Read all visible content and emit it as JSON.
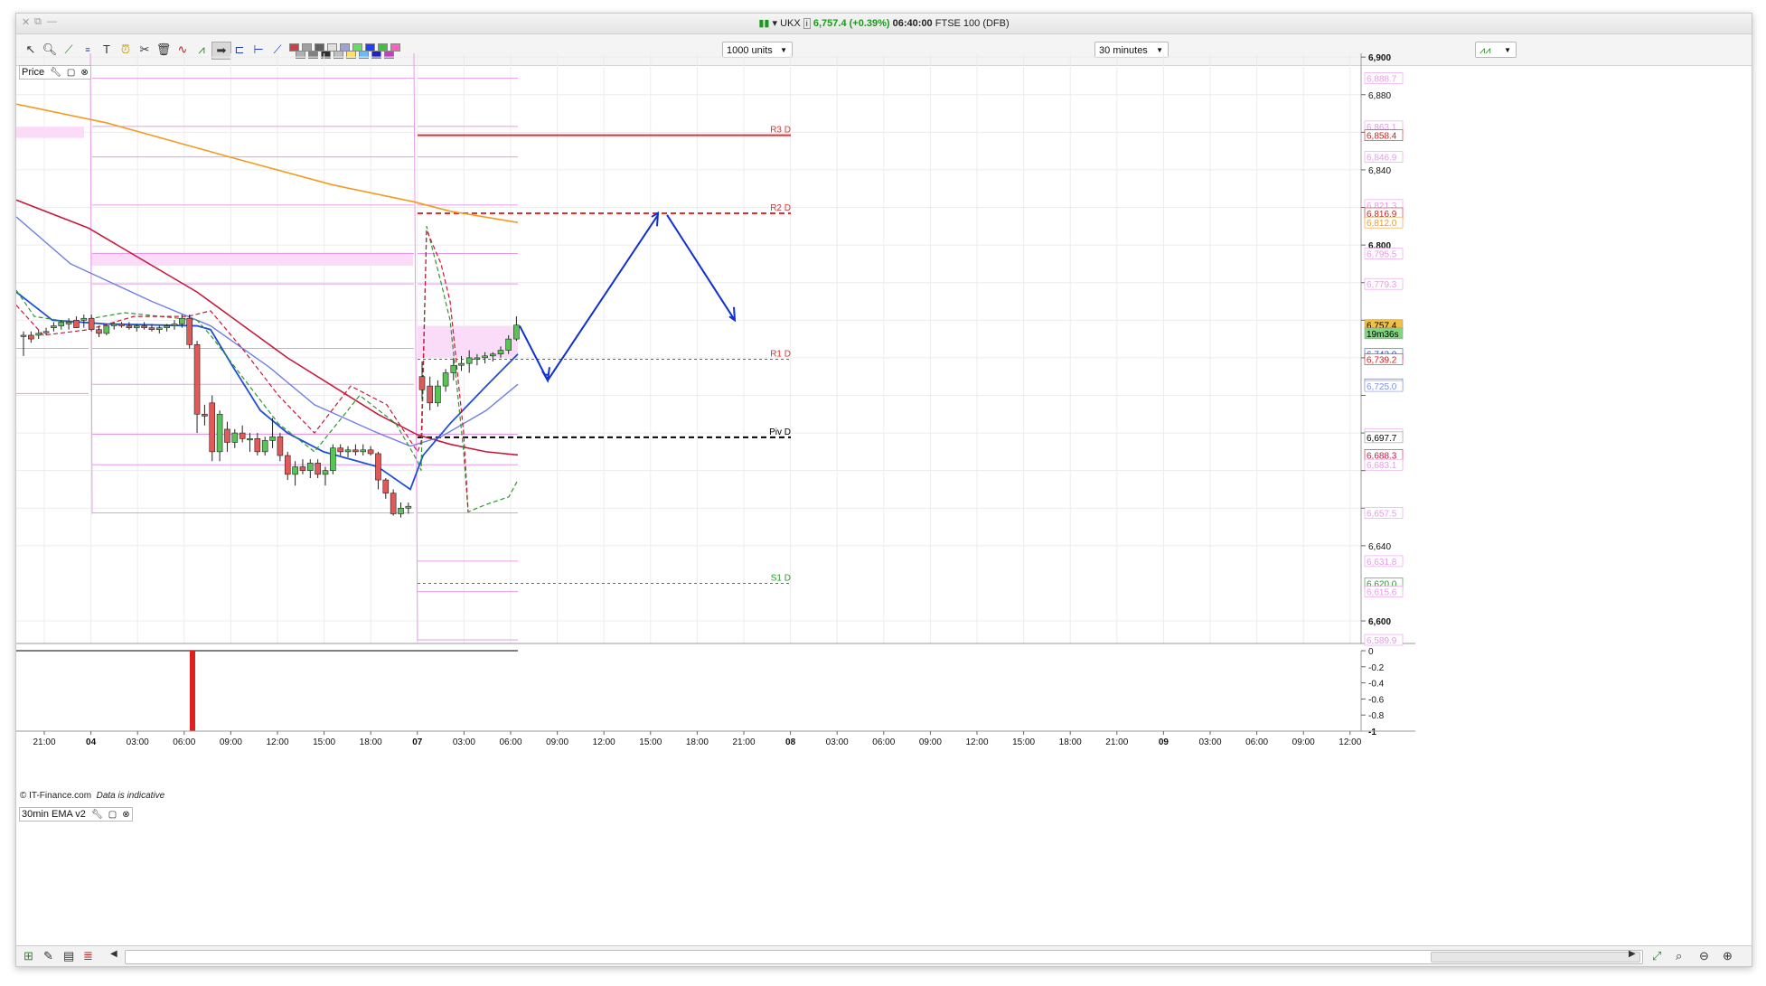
{
  "window": {
    "title_symbol": "UKX",
    "title_price": "6,757.4",
    "title_change": "(+0.39%)",
    "title_time": "06:40:00",
    "title_market": "FTSE 100 (DFB)"
  },
  "toolbar": {
    "size_select": "1000 units",
    "timeframe_select": "30 minutes",
    "icons": [
      "pointer-icon",
      "zoom-icon",
      "chart-line-icon",
      "fibonacci-icon",
      "text-icon",
      "alarm-icon",
      "tools-icon",
      "trash-icon",
      "indicator-icon",
      "wave-icon",
      "arrow-icon",
      "channel-icon",
      "horizontal-line-icon",
      "trendline-icon"
    ],
    "palette": [
      "#d04040",
      "#b0b0b0",
      "#a0a0a0",
      "#808080",
      "#606060",
      "#303030",
      "#e0e0e0",
      "#c0c0c0",
      "#a0a0e0",
      "#ffe060",
      "#60e060",
      "#60c0ff",
      "#2040ff",
      "#2020c0",
      "#40c040",
      "#c040c0",
      "#ff60c0"
    ]
  },
  "panels": {
    "price_label": "Price",
    "indicator_label": "30min EMA v2",
    "credit": "© IT-Finance.com",
    "credit_note": "Data is indicative"
  },
  "colors": {
    "candle_up": "#56c556",
    "candle_down": "#e05a5a",
    "ema_blue": "#1f4fd8",
    "ema_lightblue": "#7080e8",
    "ema_red": "#c8183c",
    "ema_orange": "#f39a20",
    "pivot_pink": "#e79be7",
    "pivot_zone": "#fadcf8",
    "forecast_arrow": "#1030d0"
  },
  "chart_data": {
    "type": "candlestick",
    "instrument": "FTSE 100 (DFB)",
    "timeframe": "30 minutes",
    "price_axis": {
      "min": 6588,
      "max": 6902,
      "ticks": [
        6600,
        6640,
        6660,
        6680,
        6700,
        6720,
        6740,
        6760,
        6780,
        6800,
        6820,
        6840,
        6860,
        6880,
        6900
      ],
      "bold_ticks": [
        6600,
        6700,
        6800,
        6900
      ],
      "unlabeled_ticks": [
        6660,
        6680,
        6720,
        6760
      ]
    },
    "time_axis": {
      "labels": [
        "21:00",
        "04",
        "03:00",
        "06:00",
        "09:00",
        "12:00",
        "15:00",
        "18:00",
        "07",
        "03:00",
        "06:00",
        "09:00",
        "12:00",
        "15:00",
        "18:00",
        "21:00",
        "08",
        "03:00",
        "06:00",
        "09:00",
        "12:00",
        "15:00",
        "18:00",
        "21:00",
        "09",
        "03:00",
        "06:00",
        "09:00",
        "12:00"
      ],
      "bold_labels": [
        "04",
        "07",
        "08",
        "09"
      ]
    },
    "candles": [
      {
        "t": "04 20:00",
        "o": 6752,
        "h": 6754,
        "l": 6741,
        "c": 6752
      },
      {
        "t": "04 20:30",
        "o": 6752,
        "h": 6754,
        "l": 6748,
        "c": 6750
      },
      {
        "t": "04 21:00",
        "o": 6752,
        "h": 6755,
        "l": 6750,
        "c": 6753
      },
      {
        "t": "04 21:30",
        "o": 6754,
        "h": 6756,
        "l": 6752,
        "c": 6754
      },
      {
        "t": "04 22:00",
        "o": 6756,
        "h": 6759,
        "l": 6754,
        "c": 6757
      },
      {
        "t": "04 22:30",
        "o": 6757,
        "h": 6760,
        "l": 6755,
        "c": 6759
      },
      {
        "t": "04 23:00",
        "o": 6758,
        "h": 6761,
        "l": 6755,
        "c": 6759
      },
      {
        "t": "04 23:30",
        "o": 6760,
        "h": 6762,
        "l": 6756,
        "c": 6756
      },
      {
        "t": "05 00:00",
        "o": 6760,
        "h": 6763,
        "l": 6756,
        "c": 6761
      },
      {
        "t": "05 00:30",
        "o": 6761,
        "h": 6763,
        "l": 6754,
        "c": 6755
      },
      {
        "t": "05 01:00",
        "o": 6755,
        "h": 6757,
        "l": 6751,
        "c": 6753
      },
      {
        "t": "05 01:30",
        "o": 6753,
        "h": 6758,
        "l": 6752,
        "c": 6757
      },
      {
        "t": "05 02:00",
        "o": 6757,
        "h": 6759,
        "l": 6755,
        "c": 6758
      },
      {
        "t": "05 02:30",
        "o": 6758,
        "h": 6759,
        "l": 6756,
        "c": 6757
      },
      {
        "t": "05 03:00",
        "o": 6757,
        "h": 6759,
        "l": 6755,
        "c": 6756
      },
      {
        "t": "05 03:30",
        "o": 6756,
        "h": 6758,
        "l": 6754,
        "c": 6757
      },
      {
        "t": "05 04:00",
        "o": 6757,
        "h": 6759,
        "l": 6755,
        "c": 6756
      },
      {
        "t": "05 04:30",
        "o": 6756,
        "h": 6758,
        "l": 6754,
        "c": 6755
      },
      {
        "t": "05 05:00",
        "o": 6755,
        "h": 6757,
        "l": 6753,
        "c": 6756
      },
      {
        "t": "05 05:30",
        "o": 6756,
        "h": 6758,
        "l": 6754,
        "c": 6757
      },
      {
        "t": "05 06:00",
        "o": 6757,
        "h": 6760,
        "l": 6755,
        "c": 6758
      },
      {
        "t": "05 06:30",
        "o": 6758,
        "h": 6763,
        "l": 6756,
        "c": 6761
      },
      {
        "t": "05 07:00",
        "o": 6761,
        "h": 6763,
        "l": 6745,
        "c": 6747
      },
      {
        "t": "05 07:30",
        "o": 6747,
        "h": 6749,
        "l": 6700,
        "c": 6710
      },
      {
        "t": "05 08:00",
        "o": 6710,
        "h": 6715,
        "l": 6704,
        "c": 6709
      },
      {
        "t": "05 08:30",
        "o": 6716,
        "h": 6720,
        "l": 6685,
        "c": 6690
      },
      {
        "t": "05 09:00",
        "o": 6690,
        "h": 6712,
        "l": 6685,
        "c": 6710
      },
      {
        "t": "05 09:30",
        "o": 6702,
        "h": 6706,
        "l": 6690,
        "c": 6695
      },
      {
        "t": "05 10:00",
        "o": 6695,
        "h": 6702,
        "l": 6692,
        "c": 6700
      },
      {
        "t": "05 10:30",
        "o": 6700,
        "h": 6704,
        "l": 6695,
        "c": 6697
      },
      {
        "t": "05 11:00",
        "o": 6697,
        "h": 6700,
        "l": 6690,
        "c": 6697
      },
      {
        "t": "05 11:30",
        "o": 6697,
        "h": 6700,
        "l": 6688,
        "c": 6690
      },
      {
        "t": "05 12:00",
        "o": 6690,
        "h": 6698,
        "l": 6688,
        "c": 6696
      },
      {
        "t": "05 12:30",
        "o": 6696,
        "h": 6708,
        "l": 6692,
        "c": 6698
      },
      {
        "t": "05 13:00",
        "o": 6698,
        "h": 6700,
        "l": 6685,
        "c": 6688
      },
      {
        "t": "05 13:30",
        "o": 6688,
        "h": 6690,
        "l": 6675,
        "c": 6678
      },
      {
        "t": "05 14:00",
        "o": 6678,
        "h": 6685,
        "l": 6672,
        "c": 6682
      },
      {
        "t": "05 14:30",
        "o": 6682,
        "h": 6686,
        "l": 6678,
        "c": 6680
      },
      {
        "t": "05 15:00",
        "o": 6680,
        "h": 6686,
        "l": 6676,
        "c": 6684
      },
      {
        "t": "05 15:30",
        "o": 6684,
        "h": 6686,
        "l": 6676,
        "c": 6678
      },
      {
        "t": "05 16:00",
        "o": 6678,
        "h": 6682,
        "l": 6672,
        "c": 6680
      },
      {
        "t": "05 16:30",
        "o": 6680,
        "h": 6694,
        "l": 6678,
        "c": 6692
      },
      {
        "t": "05 17:00",
        "o": 6692,
        "h": 6694,
        "l": 6688,
        "c": 6690
      },
      {
        "t": "05 17:30",
        "o": 6690,
        "h": 6693,
        "l": 6687,
        "c": 6691
      },
      {
        "t": "05 18:00",
        "o": 6691,
        "h": 6694,
        "l": 6688,
        "c": 6690
      },
      {
        "t": "05 18:30",
        "o": 6690,
        "h": 6694,
        "l": 6688,
        "c": 6691
      },
      {
        "t": "05 19:00",
        "o": 6691,
        "h": 6693,
        "l": 6688,
        "c": 6689
      },
      {
        "t": "05 19:30",
        "o": 6689,
        "h": 6690,
        "l": 6670,
        "c": 6675
      },
      {
        "t": "05 20:00",
        "o": 6675,
        "h": 6676,
        "l": 6665,
        "c": 6668
      },
      {
        "t": "05 20:30",
        "o": 6668,
        "h": 6670,
        "l": 6656,
        "c": 6657
      },
      {
        "t": "05 21:00",
        "o": 6657,
        "h": 6663,
        "l": 6655,
        "c": 6660
      },
      {
        "t": "05 21:30",
        "o": 6660,
        "h": 6663,
        "l": 6657,
        "c": 6661
      },
      {
        "t": "07 00:00",
        "o": 6730,
        "h": 6738,
        "l": 6718,
        "c": 6723
      },
      {
        "t": "07 00:30",
        "o": 6725,
        "h": 6730,
        "l": 6712,
        "c": 6716
      },
      {
        "t": "07 01:00",
        "o": 6716,
        "h": 6728,
        "l": 6714,
        "c": 6725
      },
      {
        "t": "07 01:30",
        "o": 6725,
        "h": 6734,
        "l": 6722,
        "c": 6732
      },
      {
        "t": "07 02:00",
        "o": 6732,
        "h": 6740,
        "l": 6728,
        "c": 6736
      },
      {
        "t": "07 02:30",
        "o": 6736,
        "h": 6741,
        "l": 6733,
        "c": 6737
      },
      {
        "t": "07 03:00",
        "o": 6737,
        "h": 6744,
        "l": 6732,
        "c": 6740
      },
      {
        "t": "07 03:30",
        "o": 6740,
        "h": 6742,
        "l": 6736,
        "c": 6740
      },
      {
        "t": "07 04:00",
        "o": 6740,
        "h": 6743,
        "l": 6737,
        "c": 6741
      },
      {
        "t": "07 04:30",
        "o": 6741,
        "h": 6743,
        "l": 6738,
        "c": 6742
      },
      {
        "t": "07 05:00",
        "o": 6742,
        "h": 6746,
        "l": 6740,
        "c": 6744
      },
      {
        "t": "07 05:30",
        "o": 6744,
        "h": 6752,
        "l": 6742,
        "c": 6750
      },
      {
        "t": "07 06:00",
        "o": 6750,
        "h": 6762,
        "l": 6749,
        "c": 6757.4
      }
    ],
    "pivot_levels": [
      {
        "name": "R3 D",
        "value": 6858.4,
        "color": "#e03030",
        "style": "solid"
      },
      {
        "name": "R2 D",
        "value": 6816.9,
        "color": "#e03030",
        "style": "dashed"
      },
      {
        "name": "R1 D",
        "value": 6739.2,
        "color": "#e03030",
        "style": "dotted"
      },
      {
        "name": "Piv D",
        "value": 6697.7,
        "color": "#000000",
        "style": "dashed"
      },
      {
        "name": "S1 D",
        "value": 6620.0,
        "color": "#2a9a2a",
        "style": "dotted"
      }
    ],
    "price_labels": [
      {
        "value": 6888.7,
        "text": "6,888.7",
        "bg": "#fff",
        "fg": "#e79be7"
      },
      {
        "value": 6863.1,
        "text": "6,863.1",
        "bg": "#fff",
        "fg": "#e79be7"
      },
      {
        "value": 6858.4,
        "text": "6,858.4",
        "bg": "#fff",
        "fg": "#d02020"
      },
      {
        "value": 6846.9,
        "text": "6,846.9",
        "bg": "#fff",
        "fg": "#e79be7"
      },
      {
        "value": 6821.3,
        "text": "6,821.3",
        "bg": "#fff",
        "fg": "#e79be7"
      },
      {
        "value": 6816.9,
        "text": "6,816.9",
        "bg": "#fff",
        "fg": "#d02020"
      },
      {
        "value": 6812.0,
        "text": "6,812.0",
        "bg": "#fff",
        "fg": "#f39a20"
      },
      {
        "value": 6795.5,
        "text": "6,795.5",
        "bg": "#fff",
        "fg": "#e79be7"
      },
      {
        "value": 6779.3,
        "text": "6,779.3",
        "bg": "#fff",
        "fg": "#e79be7"
      },
      {
        "value": 6757.4,
        "text": "6,757.4",
        "bg": "#f0c040",
        "fg": "#000"
      },
      {
        "value": 6753.0,
        "text": "19m36s",
        "bg": "#7fd87f",
        "fg": "#000"
      },
      {
        "value": 6742.0,
        "text": "6,742.0",
        "bg": "#fff",
        "fg": "#1f4fd8"
      },
      {
        "value": 6739.2,
        "text": "6,739.2",
        "bg": "#fff",
        "fg": "#d02020"
      },
      {
        "value": 6725.9,
        "text": "6,725.9",
        "bg": "#fff",
        "fg": "#5060e0"
      },
      {
        "value": 6725.0,
        "text": "6,725.0",
        "bg": "#fff",
        "fg": "#8090f0"
      },
      {
        "value": 6699.3,
        "text": "6,699.3",
        "bg": "#fff",
        "fg": "#e79be7"
      },
      {
        "value": 6697.7,
        "text": "6,697.7",
        "bg": "#fff",
        "fg": "#000"
      },
      {
        "value": 6688.3,
        "text": "6,688.3",
        "bg": "#fff",
        "fg": "#c8183c"
      },
      {
        "value": 6683.1,
        "text": "6,683.1",
        "bg": "#fff",
        "fg": "#e79be7"
      },
      {
        "value": 6657.5,
        "text": "6,657.5",
        "bg": "#fff",
        "fg": "#e79be7"
      },
      {
        "value": 6631.8,
        "text": "6,631.8",
        "bg": "#fff",
        "fg": "#e79be7"
      },
      {
        "value": 6620.0,
        "text": "6,620.0",
        "bg": "#fff",
        "fg": "#2a9a2a"
      },
      {
        "value": 6615.6,
        "text": "6,615.6",
        "bg": "#fff",
        "fg": "#e79be7"
      },
      {
        "value": 6589.9,
        "text": "6,589.9",
        "bg": "#fff",
        "fg": "#e79be7"
      }
    ],
    "forecast_path": [
      [
        6757,
        "07 06:00"
      ],
      [
        6728,
        "07 08:30"
      ],
      [
        6817,
        "07 15:30"
      ],
      [
        6760,
        "07 20:00"
      ]
    ],
    "indicator": {
      "name": "30min EMA v2",
      "ticks": [
        "0",
        "-0.2",
        "-0.4",
        "-0.6",
        "-0.8",
        "-1"
      ],
      "min": -1,
      "max": 0
    }
  }
}
